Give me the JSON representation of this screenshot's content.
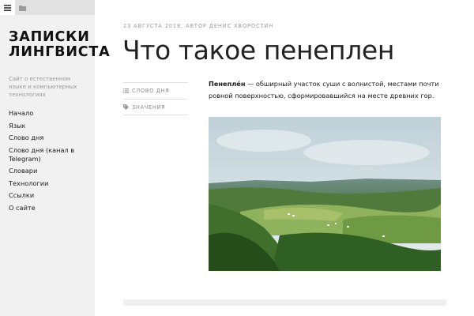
{
  "sidebar": {
    "title": "ЗАПИСКИ ЛИНГВИСТА",
    "description": "Сайт о естественном языке и компьютерных технологиях",
    "menu": [
      {
        "label": "Начало"
      },
      {
        "label": "Язык"
      },
      {
        "label": "Слово дня"
      },
      {
        "label": "Слово дня (канал в Telegram)"
      },
      {
        "label": "Словари"
      },
      {
        "label": "Технологии"
      },
      {
        "label": "Ссылки"
      },
      {
        "label": "О сайте"
      }
    ],
    "tools": [
      {
        "icon": "menu-icon",
        "active": true
      },
      {
        "icon": "folder-icon",
        "active": false
      }
    ]
  },
  "post": {
    "meta": "23 августа 2018, автор Денис Хворостин",
    "title": "Что такое пенеплен",
    "categories": [
      {
        "icon": "list-icon",
        "label": "Слово дня"
      },
      {
        "icon": "tag-icon",
        "label": "Значения"
      }
    ],
    "term": "Пенепле́н",
    "definition": " — обширный участок суши с волнистой, местами почти ровной поверхностью, сформировавшийся на месте древних гор."
  },
  "colors": {
    "sidebar_bg": "#f1f1f1",
    "toolbar_bg": "#e1e1e1",
    "text_muted": "#9a9a9a"
  }
}
